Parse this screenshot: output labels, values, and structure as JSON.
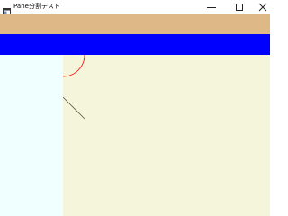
{
  "window": {
    "title": "Pane分割テスト",
    "icon": "window-app-icon"
  },
  "controls": {
    "minimize_icon": "minimize-icon",
    "maximize_icon": "maximize-icon",
    "close_icon": "close-icon"
  },
  "panes": {
    "top_color": "#DEB887",
    "blue_color": "#0000FF",
    "left_color": "#F0FFFF",
    "right_color": "#F5F5DC"
  },
  "drawing": {
    "arc_color": "#FF0000",
    "line_color": "#5A5A46"
  }
}
